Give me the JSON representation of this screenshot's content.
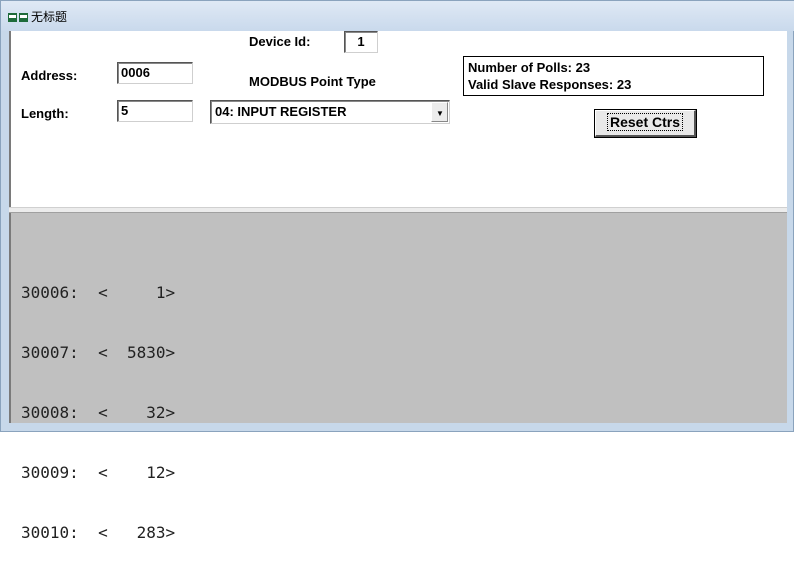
{
  "window": {
    "title": "无标题",
    "icon": "modscan-document-icon"
  },
  "form": {
    "address_label": "Address:",
    "address_value": "0006",
    "length_label": "Length:",
    "length_value": "5",
    "device_id_label": "Device Id:",
    "device_id_value": "1",
    "point_type_label": "MODBUS Point Type",
    "point_type_value": "04: INPUT REGISTER"
  },
  "stats": {
    "polls": "Number of Polls: 23",
    "responses": "Valid Slave Responses: 23",
    "reset_label": "Reset Ctrs"
  },
  "registers": [
    "30006:  <     1>",
    "30007:  <  5830>",
    "30008:  <    32>",
    "30009:  <    12>",
    "30010:  <   283>"
  ]
}
